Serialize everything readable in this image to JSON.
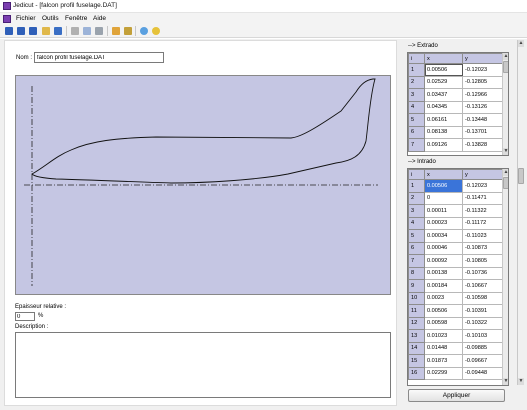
{
  "window": {
    "title": "Jedicut - [falcon profil fuselage.DAT]"
  },
  "menu": [
    "Fichier",
    "Outils",
    "Fenêtre",
    "Aide"
  ],
  "toolbar": {
    "buttons": [
      {
        "icon": "doc-d-icon",
        "color": "#2f5fb8"
      },
      {
        "icon": "doc-p-icon",
        "color": "#2f5fb8"
      },
      {
        "icon": "doc-b-icon",
        "color": "#2f5fb8"
      },
      {
        "icon": "open-folder-icon",
        "color": "#e0b84a"
      },
      {
        "icon": "save-icon",
        "color": "#3a6ec4"
      },
      {
        "icon": "tool-icon",
        "color": "#b0b0b0"
      },
      {
        "icon": "grid-icon",
        "color": "#9cb3d8"
      },
      {
        "icon": "print-icon",
        "color": "#9aa3ad"
      },
      {
        "icon": "refresh-icon",
        "color": "#e0a43a"
      },
      {
        "icon": "zoom-icon",
        "color": "#c3a03a"
      },
      {
        "icon": "help-icon",
        "color": "#5aa0e0"
      },
      {
        "icon": "star-icon",
        "color": "#e6c23a"
      }
    ]
  },
  "form": {
    "name_label": "Nom :",
    "name_value": "falcon profil fuselage.DAT",
    "thickness_label": "Epaisseur relative :",
    "thickness_value": "0",
    "thickness_unit": "%",
    "description_label": "Description :",
    "description_value": ""
  },
  "extrados": {
    "label": "--> Extrado",
    "headers": [
      "i",
      "x",
      "y"
    ],
    "rows": [
      [
        "1",
        "0.00506",
        "-0.12023"
      ],
      [
        "2",
        "0.02529",
        "-0.12805"
      ],
      [
        "3",
        "0.03437",
        "-0.12966"
      ],
      [
        "4",
        "0.04345",
        "-0.13126"
      ],
      [
        "5",
        "0.06161",
        "-0.13448"
      ],
      [
        "6",
        "0.08138",
        "-0.13701"
      ],
      [
        "7",
        "0.09126",
        "-0.13828"
      ]
    ]
  },
  "intrados": {
    "label": "--> Intrado",
    "headers": [
      "i",
      "x",
      "y"
    ],
    "rows": [
      [
        "1",
        "0.00506",
        "-0.12023"
      ],
      [
        "2",
        "0",
        "-0.11471"
      ],
      [
        "3",
        "0.00011",
        "-0.11322"
      ],
      [
        "4",
        "0.00023",
        "-0.11172"
      ],
      [
        "5",
        "0.00034",
        "-0.11023"
      ],
      [
        "6",
        "0.00046",
        "-0.10873"
      ],
      [
        "7",
        "0.00092",
        "-0.10805"
      ],
      [
        "8",
        "0.00138",
        "-0.10736"
      ],
      [
        "9",
        "0.00184",
        "-0.10667"
      ],
      [
        "10",
        "0.0023",
        "-0.10598"
      ],
      [
        "11",
        "0.00506",
        "-0.10391"
      ],
      [
        "12",
        "0.00598",
        "-0.10322"
      ],
      [
        "13",
        "0.01023",
        "-0.10103"
      ],
      [
        "14",
        "0.01448",
        "-0.09885"
      ],
      [
        "15",
        "0.01873",
        "-0.09667"
      ],
      [
        "16",
        "0.02299",
        "-0.09448"
      ]
    ]
  },
  "apply_label": "Appliquer",
  "colors": {
    "plot_bg": "#c5c6e3",
    "header_bg": "#c5c6e3",
    "selection": "#3a74d9"
  }
}
